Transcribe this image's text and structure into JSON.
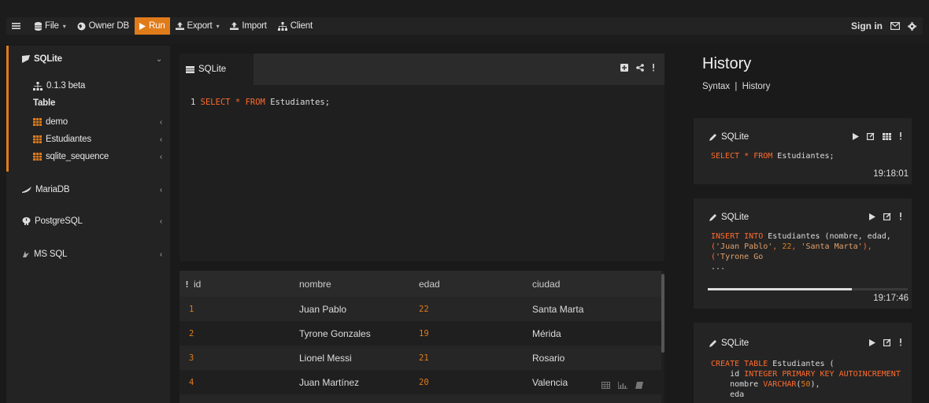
{
  "toolbar": {
    "file": "File",
    "owner_db": "Owner DB",
    "run": "Run",
    "export": "Export",
    "import": "Import",
    "client": "Client",
    "sign_in": "Sign in",
    "accent_color": "#e07b1a"
  },
  "sidebar": {
    "sqlite": "SQLite",
    "version": "0.1.3 beta",
    "table_label": "Table",
    "tables": [
      "demo",
      "Estudiantes",
      "sqlite_sequence"
    ],
    "mariadb": "MariaDB",
    "postgresql": "PostgreSQL",
    "mssql": "MS SQL"
  },
  "editor": {
    "tab": "SQLite",
    "line_number": "1",
    "code": {
      "select": "SELECT",
      "star": "*",
      "from": "FROM",
      "rest": "Estudiantes;"
    }
  },
  "results": {
    "columns": [
      "id",
      "nombre",
      "edad",
      "ciudad"
    ],
    "rows": [
      [
        "1",
        "Juan Pablo",
        "22",
        "Santa Marta"
      ],
      [
        "2",
        "Tyrone Gonzales",
        "19",
        "Mérida"
      ],
      [
        "3",
        "Lionel Messi",
        "21",
        "Rosario"
      ],
      [
        "4",
        "Juan Martínez",
        "20",
        "Valencia"
      ]
    ]
  },
  "history": {
    "title": "History",
    "syntax": "Syntax",
    "history_link": "History",
    "separator": "|",
    "cards": [
      {
        "label": "SQLite",
        "kw1": "SELECT",
        "t1": " * ",
        "kw2": "FROM",
        "t2": " Estudiantes;",
        "time": "19:18:01"
      },
      {
        "label": "SQLite",
        "kw1": "INSERT INTO",
        "t1": " Estudiantes (nombre, edad, ",
        "l2a": "(",
        "l2s1": "'Juan Pablo'",
        "l2b": ", ",
        "l2n": "22",
        "l2c": ", ",
        "l2s2": "'Santa Marta'",
        "l2d": "),",
        "l3a": "(",
        "l3s": "'Tyrone Go",
        "ellipsis": "...",
        "progress": 0.72,
        "time": "19:17:46"
      },
      {
        "label": "SQLite",
        "kw1": "CREATE TABLE",
        "t1": " Estudiantes (",
        "l2a": "    id ",
        "l2k": "INTEGER PRIMARY KEY AUTOINCREMENT",
        "l3a": "    nombre ",
        "l3k": "VARCHAR",
        "l3b": "(",
        "l3n": "50",
        "l3c": "),",
        "l4a": "    eda"
      }
    ]
  }
}
